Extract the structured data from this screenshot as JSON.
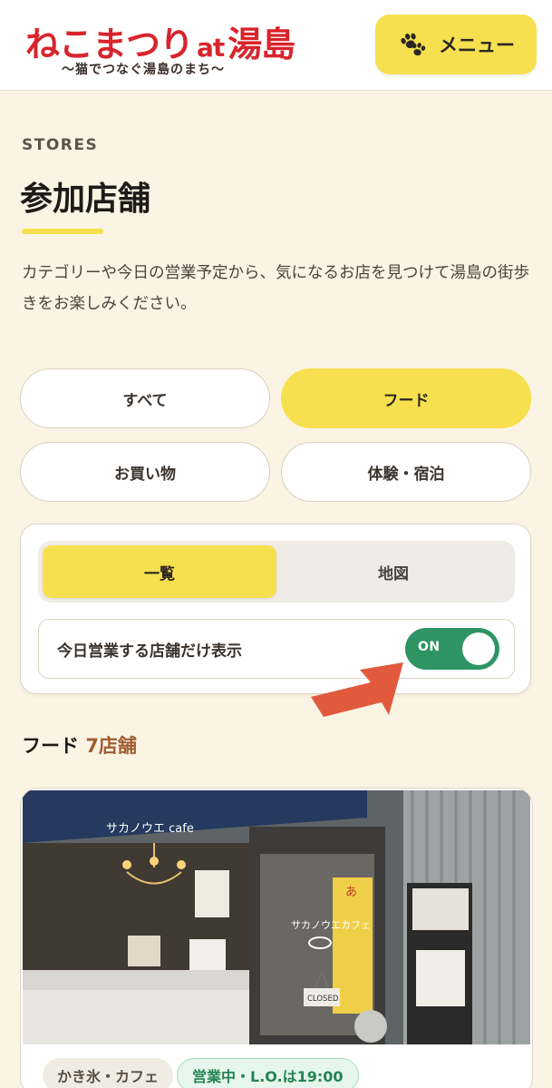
{
  "header": {
    "logo_main_pre": "ねこまつり",
    "logo_main_at": "at",
    "logo_main_post": "湯島",
    "logo_sub": "〜猫でつなぐ湯島のまち〜",
    "menu_label": "メニュー",
    "menu_icon": "paw-icon"
  },
  "page": {
    "eyebrow": "STORES",
    "title": "参加店舗",
    "intro": "カテゴリーや今日の営業予定から、気になるお店を見つけて湯島の街歩きをお楽しみください。"
  },
  "categories": [
    {
      "label": "すべて",
      "active": false
    },
    {
      "label": "フード",
      "active": true
    },
    {
      "label": "お買い物",
      "active": false
    },
    {
      "label": "体験・宿泊",
      "active": false
    }
  ],
  "view_toggle": [
    {
      "label": "一覧",
      "active": true
    },
    {
      "label": "地図",
      "active": false
    }
  ],
  "today_filter": {
    "label": "今日営業する店舗だけ表示",
    "state": "ON"
  },
  "results": {
    "category": "フード",
    "count": "7店舗"
  },
  "store_card": {
    "photo_sign": "サカノウエ cafe",
    "photo_window": "サカノウエカフェ",
    "photo_closed": "CLOSED",
    "category_tag": "かき氷・カフェ",
    "status_tag": "営業中・L.O.は19:00"
  },
  "colors": {
    "accent_yellow": "#f7e04f",
    "brand_red": "#d8242c",
    "toggle_green": "#2e9464",
    "background": "#fbf4e4",
    "arrow": "#e15a3e"
  }
}
